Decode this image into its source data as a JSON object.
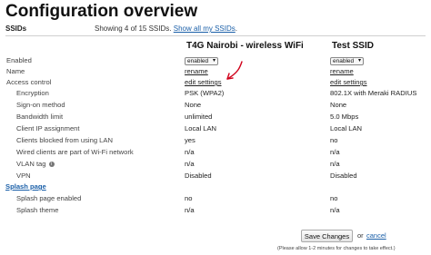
{
  "page": {
    "title": "Configuration overview"
  },
  "ssids": {
    "label": "SSIDs",
    "showing_text": "Showing 4 of 15 SSIDs.",
    "show_all_link": "Show all my SSIDs"
  },
  "columns": [
    {
      "name": "T4G Nairobi - wireless WiFi"
    },
    {
      "name": "Test SSID"
    }
  ],
  "rows": {
    "enabled": {
      "label": "Enabled",
      "values": [
        "enabled",
        "enabled"
      ]
    },
    "name": {
      "label": "Name",
      "values": [
        "rename",
        "rename"
      ]
    },
    "access_control": {
      "label": "Access control",
      "values": [
        "edit settings",
        "edit settings"
      ]
    },
    "encryption": {
      "label": "Encryption",
      "values": [
        "PSK (WPA2)",
        "802.1X with Meraki RADIUS"
      ]
    },
    "sign_on": {
      "label": "Sign-on method",
      "values": [
        "None",
        "None"
      ]
    },
    "bandwidth": {
      "label": "Bandwidth limit",
      "values": [
        "unlimited",
        "5.0 Mbps"
      ]
    },
    "client_ip": {
      "label": "Client IP assignment",
      "values": [
        "Local LAN",
        "Local LAN"
      ]
    },
    "blocked_lan": {
      "label": "Clients blocked from using LAN",
      "values": [
        "yes",
        "no"
      ]
    },
    "wired_clients": {
      "label": "Wired clients are part of Wi-Fi network",
      "values": [
        "n/a",
        "n/a"
      ]
    },
    "vlan_tag": {
      "label": "VLAN tag",
      "values": [
        "n/a",
        "n/a"
      ]
    },
    "vpn": {
      "label": "VPN",
      "values": [
        "Disabled",
        "Disabled"
      ]
    },
    "splash_enabled": {
      "label": "Splash page enabled",
      "values": [
        "no",
        "no"
      ]
    },
    "splash_theme": {
      "label": "Splash theme",
      "values": [
        "n/a",
        "n/a"
      ]
    }
  },
  "splash_section": {
    "label": "Splash page"
  },
  "icons": {
    "info": "info-icon",
    "dropdown": "chevron-down-icon"
  },
  "colors": {
    "link": "#1a5fa8",
    "annotation_arrow": "#d0021b"
  },
  "footer": {
    "save_label": "Save Changes",
    "or_text": "or",
    "cancel_label": "cancel",
    "note": "(Please allow 1-2 minutes for changes to take effect.)"
  }
}
